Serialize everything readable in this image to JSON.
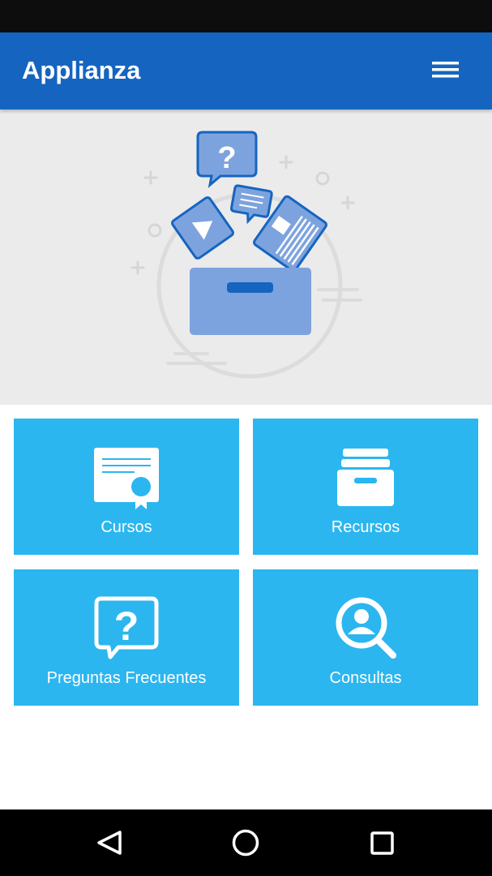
{
  "app_bar": {
    "title": "Applianza",
    "menu_icon": "hamburger-menu-icon"
  },
  "colors": {
    "app_bar": "#1565c0",
    "tile": "#2bb6f0",
    "illustration": "#7da3de",
    "hero_bg": "#ebebeb"
  },
  "tiles": [
    {
      "label": "Cursos",
      "icon": "certificate-icon"
    },
    {
      "label": "Recursos",
      "icon": "archive-box-icon"
    },
    {
      "label": "Preguntas Frecuentes",
      "icon": "question-bubble-icon"
    },
    {
      "label": "Consultas",
      "icon": "search-user-icon"
    }
  ],
  "nav_bar": {
    "back": "back-triangle-icon",
    "home": "home-circle-icon",
    "recents": "recents-square-icon"
  }
}
